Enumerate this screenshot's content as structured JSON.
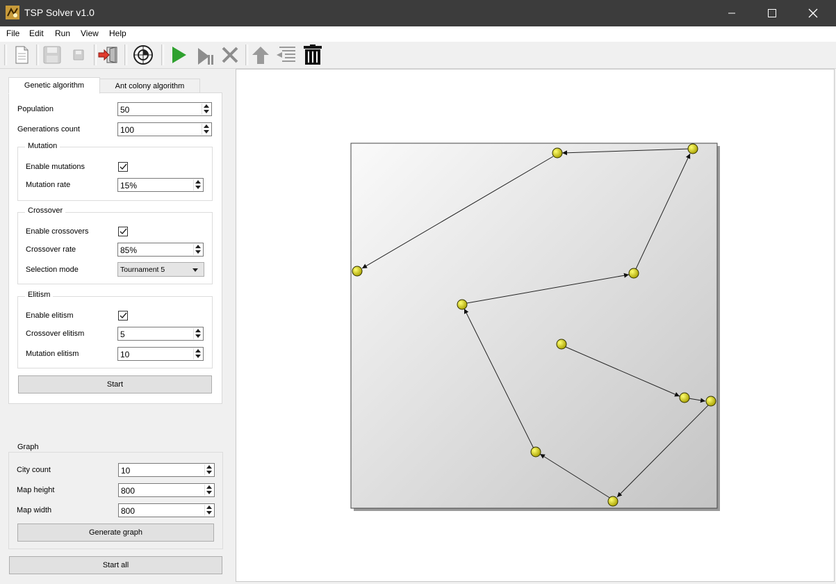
{
  "window": {
    "title": "TSP Solver v1.0"
  },
  "menu": [
    "File",
    "Edit",
    "Run",
    "View",
    "Help"
  ],
  "toolbar": {
    "new": "new-document-icon",
    "save": "save-icon",
    "save_small": "save-small-icon",
    "exit": "exit-icon",
    "target": "target-icon",
    "run": "play-icon",
    "step": "step-icon",
    "stop": "stop-icon",
    "up": "up-arrow-icon",
    "list": "list-icon",
    "delete": "trash-icon"
  },
  "tabs": {
    "genetic": "Genetic algorithm",
    "ant": "Ant colony algorithm"
  },
  "genetic": {
    "population_label": "Population",
    "population": "50",
    "generations_label": "Generations count",
    "generations": "100",
    "mutation": {
      "title": "Mutation",
      "enable_label": "Enable mutations",
      "enabled": true,
      "rate_label": "Mutation rate",
      "rate": "15%"
    },
    "crossover": {
      "title": "Crossover",
      "enable_label": "Enable crossovers",
      "enabled": true,
      "rate_label": "Crossover rate",
      "rate": "85%",
      "selection_label": "Selection mode",
      "selection": "Tournament 5"
    },
    "elitism": {
      "title": "Elitism",
      "enable_label": "Enable elitism",
      "enabled": true,
      "crossover_label": "Crossover elitism",
      "crossover": "5",
      "mutation_label": "Mutation elitism",
      "mutation": "10"
    },
    "start_label": "Start"
  },
  "graph": {
    "title": "Graph",
    "city_count_label": "City count",
    "city_count": "10",
    "map_height_label": "Map height",
    "map_height": "800",
    "map_width_label": "Map width",
    "map_width": "800",
    "generate_label": "Generate graph"
  },
  "start_all_label": "Start all",
  "colors": {
    "node_fill": "#d9d400",
    "node_stroke": "#333300",
    "edge": "#222222"
  }
}
